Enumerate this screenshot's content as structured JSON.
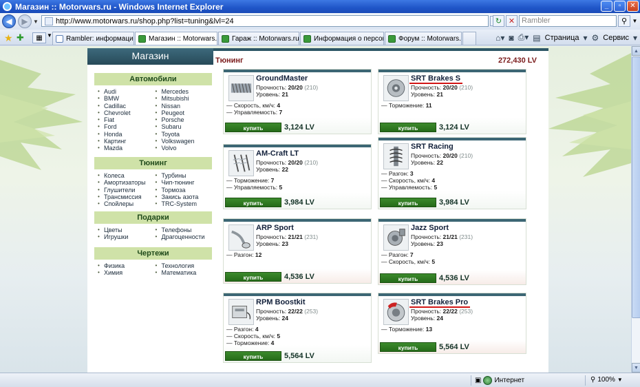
{
  "window": {
    "title": "Магазин :: Motorwars.ru - Windows Internet Explorer"
  },
  "browser": {
    "url": "http://www.motorwars.ru/shop.php?list=tuning&lvl=24",
    "search_placeholder": "Rambler",
    "tabs": [
      {
        "label": "Rambler: информационно...",
        "active": false,
        "icon": "rambler-icon"
      },
      {
        "label": "Магазин :: Motorwars.ru",
        "active": true,
        "icon": "site-icon"
      },
      {
        "label": "Гараж :: Motorwars.ru",
        "active": false,
        "icon": "site-icon"
      },
      {
        "label": "Информация о персонаж...",
        "active": false,
        "icon": "site-icon"
      },
      {
        "label": "Форум :: Motorwars.ru",
        "active": false,
        "icon": "site-icon"
      }
    ],
    "toolbar": {
      "page_label": "Страница",
      "tools_label": "Сервис"
    }
  },
  "sidebar": {
    "header": "Магазин",
    "categories": [
      {
        "title": "Автомобили",
        "col1": [
          "Audi",
          "BMW",
          "Cadillac",
          "Chevrolet",
          "Fiat",
          "Ford",
          "Honda",
          "Картинг",
          "Mazda"
        ],
        "col2": [
          "Mercedes",
          "Mitsubishi",
          "Nissan",
          "Peugeot",
          "Porsche",
          "Subaru",
          "Toyota",
          "Volkswagen",
          "Volvo"
        ]
      },
      {
        "title": "Тюнинг",
        "col1": [
          "Колеса",
          "Амортизаторы",
          "Глушители",
          "Трансмиссия",
          "Спойлеры"
        ],
        "col2": [
          "Турбины",
          "Чип-тюнинг",
          "Тормоза",
          "Закись азота",
          "TRC-System"
        ]
      },
      {
        "title": "Подарки",
        "col1": [
          "Цветы",
          "Игрушки"
        ],
        "col2": [
          "Телефоны",
          "Драгоценности"
        ]
      },
      {
        "title": "Чертежи",
        "col1": [
          "Физика",
          "Химия"
        ],
        "col2": [
          "Технология",
          "Математика"
        ]
      }
    ]
  },
  "main": {
    "title": "Тюнинг",
    "balance": "272,430 LV",
    "buy_label": "купить",
    "durability_label": "Прочность:",
    "level_label": "Уровень:",
    "items": [
      {
        "name": "GroundMaster",
        "durability": "20/20",
        "durability_max": "(210)",
        "level": "21",
        "stats": [
          {
            "label": "Скорость, км/ч:",
            "value": "4"
          },
          {
            "label": "Управляемость:",
            "value": "7"
          }
        ],
        "price": "3,124 LV",
        "thumb": "wheel-pack-icon",
        "highlight": false
      },
      {
        "name": "SRT Brakes S",
        "durability": "20/20",
        "durability_max": "(210)",
        "level": "21",
        "stats": [
          {
            "label": "Торможение:",
            "value": "11"
          }
        ],
        "price": "3,124 LV",
        "thumb": "brake-disc-icon",
        "highlight": true
      },
      {
        "name": "AM-Craft LT",
        "durability": "20/20",
        "durability_max": "(210)",
        "level": "22",
        "stats": [
          {
            "label": "Торможение:",
            "value": "7"
          },
          {
            "label": "Управляемость:",
            "value": "5"
          }
        ],
        "price": "3,984 LV",
        "thumb": "shock-absorber-icon",
        "highlight": false
      },
      {
        "name": "SRT Racing",
        "durability": "20/20",
        "durability_max": "(210)",
        "level": "22",
        "stats": [
          {
            "label": "Разгон:",
            "value": "3"
          },
          {
            "label": "Скорость, км/ч:",
            "value": "4"
          },
          {
            "label": "Управляемость:",
            "value": "5"
          }
        ],
        "price": "3,984 LV",
        "thumb": "coilover-icon",
        "highlight": false
      },
      {
        "name": "ARP Sport",
        "durability": "21/21",
        "durability_max": "(231)",
        "level": "23",
        "stats": [
          {
            "label": "Разгон:",
            "value": "12"
          }
        ],
        "price": "4,536 LV",
        "thumb": "exhaust-icon",
        "highlight": false
      },
      {
        "name": "Jazz Sport",
        "durability": "21/21",
        "durability_max": "(231)",
        "level": "23",
        "stats": [
          {
            "label": "Разгон:",
            "value": "7"
          },
          {
            "label": "Скорость, км/ч:",
            "value": "5"
          }
        ],
        "price": "4,536 LV",
        "thumb": "turbo-icon",
        "highlight": false
      },
      {
        "name": "RPM Boostkit",
        "durability": "22/22",
        "durability_max": "(253)",
        "level": "24",
        "stats": [
          {
            "label": "Разгон:",
            "value": "4"
          },
          {
            "label": "Скорость, км/ч:",
            "value": "5"
          },
          {
            "label": "Торможение:",
            "value": "4"
          }
        ],
        "price": "5,564 LV",
        "thumb": "chip-box-icon",
        "highlight": false
      },
      {
        "name": "SRT Brakes Pro",
        "durability": "22/22",
        "durability_max": "(253)",
        "level": "24",
        "stats": [
          {
            "label": "Торможение:",
            "value": "13"
          }
        ],
        "price": "5,564 LV",
        "thumb": "brake-disc-pro-icon",
        "highlight": true
      }
    ]
  },
  "status": {
    "zone": "Интернет",
    "zoom": "100%"
  }
}
